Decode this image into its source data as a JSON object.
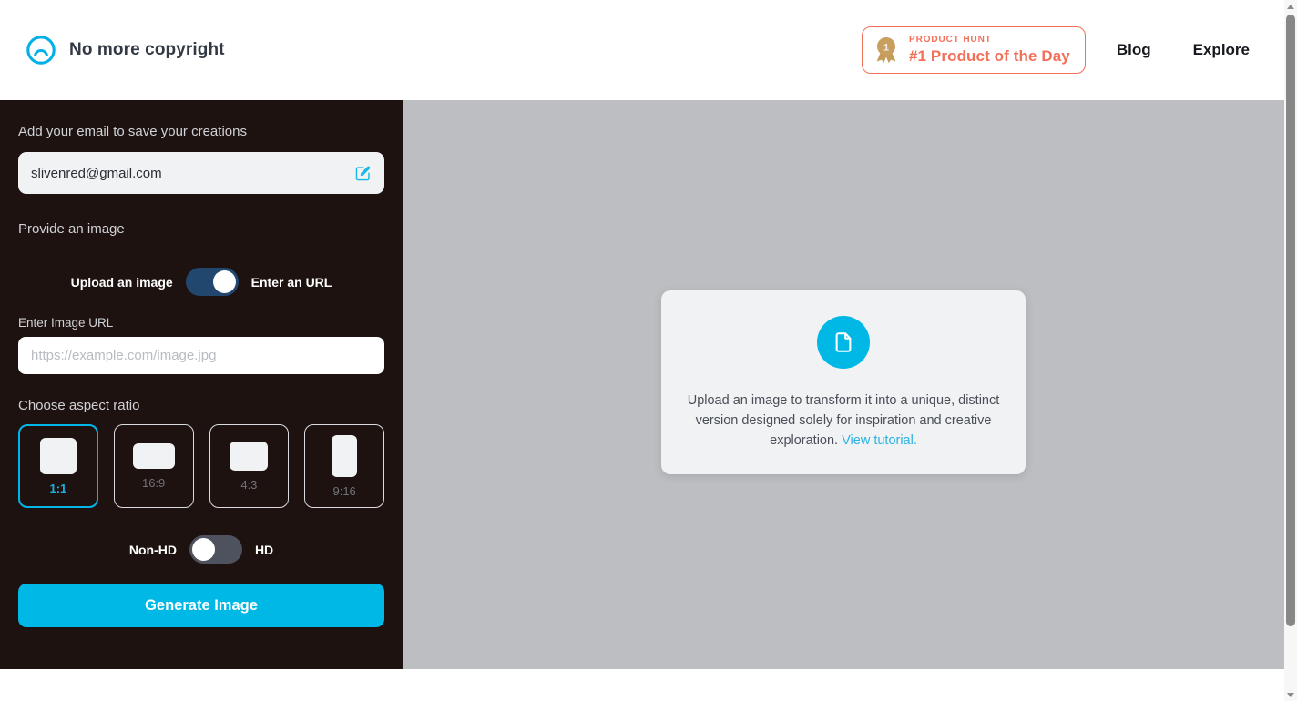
{
  "header": {
    "logo_icon": "nmc-circle-logo-icon",
    "brand_title": "No more copyright",
    "product_hunt": {
      "medal_icon": "medal-icon",
      "kicker": "PRODUCT HUNT",
      "title": "#1 Product of the Day",
      "border_color": "#f2705a",
      "text_color": "#f2705a",
      "medal_color": "#c59b5a"
    },
    "nav": [
      {
        "label": "Blog"
      },
      {
        "label": "Explore"
      }
    ]
  },
  "sidebar": {
    "background_color": "#1e1210",
    "email": {
      "label": "Add your email to save your creations",
      "value": "slivenred@gmail.com",
      "edit_icon": "edit-square-icon"
    },
    "provide_image": {
      "section_label": "Provide an image",
      "toggle_left_label": "Upload an image",
      "toggle_right_label": "Enter an URL",
      "toggle_state": "on",
      "toggle_track_color": "#21476f",
      "url_label": "Enter Image URL",
      "url_value": "",
      "url_placeholder": "https://example.com/image.jpg"
    },
    "aspect_ratio": {
      "label": "Choose aspect ratio",
      "selected": "1:1",
      "accent_color": "#00b5e8",
      "options": [
        {
          "label": "1:1",
          "shape_w": 40,
          "shape_h": 40,
          "selected": true
        },
        {
          "label": "16:9",
          "shape_w": 46,
          "shape_h": 28,
          "selected": false
        },
        {
          "label": "4:3",
          "shape_w": 42,
          "shape_h": 32,
          "selected": false
        },
        {
          "label": "9:16",
          "shape_w": 28,
          "shape_h": 46,
          "selected": false
        }
      ]
    },
    "quality": {
      "left_label": "Non-HD",
      "right_label": "HD",
      "toggle_state": "off",
      "toggle_track_color": "#4e515e"
    },
    "generate_button": {
      "label": "Generate Image",
      "color": "#00b8e6"
    }
  },
  "main": {
    "background_color": "#bcbec2",
    "upload_card": {
      "icon": "document-icon",
      "icon_circle_color": "#00b8e6",
      "text": "Upload an image to transform it into a unique, distinct version designed solely for inspiration and creative exploration.",
      "link_text": "View tutorial.",
      "link_color": "#2bb3e3"
    }
  },
  "scrollbar": {
    "up_arrow_icon": "caret-up-icon",
    "down_arrow_icon": "caret-down-icon"
  }
}
